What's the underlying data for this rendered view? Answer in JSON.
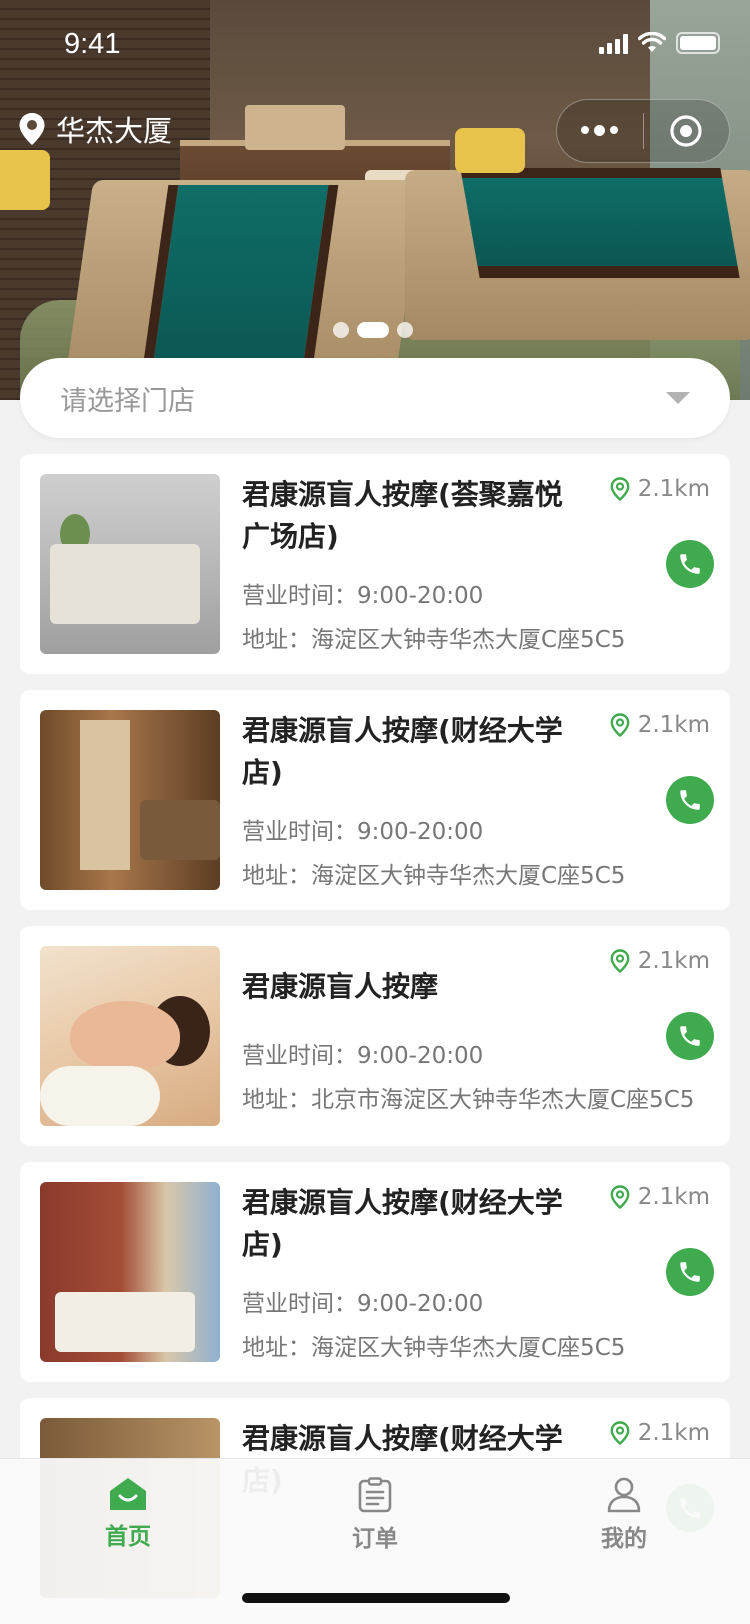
{
  "status_bar": {
    "time": "9:41"
  },
  "header": {
    "location": "华杰大厦",
    "capsule": {
      "more_icon": "more-dots-icon",
      "close_icon": "target-circle-icon"
    }
  },
  "banner": {
    "page_count": 3,
    "active_index": 1
  },
  "store_selector": {
    "placeholder": "请选择门店"
  },
  "stores": [
    {
      "name": "君康源盲人按摩(荟聚嘉悦广场店)",
      "distance": "2.1km",
      "hours": "营业时间：9:00-20:00",
      "address": "地址：海淀区大钟寺华杰大厦C座5C5"
    },
    {
      "name": "君康源盲人按摩(财经大学店)",
      "distance": "2.1km",
      "hours": "营业时间：9:00-20:00",
      "address": "地址：海淀区大钟寺华杰大厦C座5C5"
    },
    {
      "name": "君康源盲人按摩",
      "distance": "2.1km",
      "hours": "营业时间：9:00-20:00",
      "address": "地址：北京市海淀区大钟寺华杰大厦C座5C5"
    },
    {
      "name": "君康源盲人按摩(财经大学店)",
      "distance": "2.1km",
      "hours": "营业时间：9:00-20:00",
      "address": "地址：海淀区大钟寺华杰大厦C座5C5"
    },
    {
      "name": "君康源盲人按摩(财经大学店)",
      "distance": "2.1km"
    }
  ],
  "tabbar": {
    "items": [
      {
        "label": "首页",
        "icon": "home-icon",
        "active": true
      },
      {
        "label": "订单",
        "icon": "clipboard-icon",
        "active": false
      },
      {
        "label": "我的",
        "icon": "user-icon",
        "active": false
      }
    ]
  },
  "colors": {
    "accent": "#3faa4e",
    "background": "#f2f2f2",
    "card": "#ffffff",
    "muted_text": "#777777"
  }
}
